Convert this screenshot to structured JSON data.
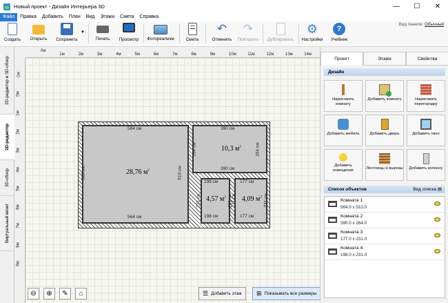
{
  "window": {
    "title": "Новый проект - Дизайн Интерьера 3D",
    "min": "—",
    "max": "☐",
    "close": "✕"
  },
  "menu": [
    "Файл",
    "Правка",
    "Добавить",
    "План",
    "Вид",
    "Этажи",
    "Смета",
    "Справка"
  ],
  "toolbar": {
    "items": [
      {
        "label": "Создать",
        "icon": "new-document-icon",
        "disabled": false
      },
      {
        "label": "Открыть",
        "icon": "folder-icon",
        "disabled": false
      },
      {
        "label": "Сохранить",
        "icon": "floppy-disk-icon",
        "disabled": false
      },
      {
        "label": "Печать",
        "icon": "printer-icon",
        "disabled": false
      },
      {
        "label": "Просмотр",
        "icon": "monitor-icon",
        "disabled": false
      },
      {
        "label": "Фотореализм",
        "icon": "photo-icon",
        "disabled": false
      },
      {
        "label": "Смета",
        "icon": "estimate-icon",
        "disabled": false
      },
      {
        "label": "Отменить",
        "icon": "undo-icon",
        "disabled": false
      },
      {
        "label": "Повторить",
        "icon": "redo-icon",
        "disabled": true
      },
      {
        "label": "Дублировать",
        "icon": "duplicate-icon",
        "disabled": true
      },
      {
        "label": "Настройки",
        "icon": "gear-icon",
        "disabled": false
      },
      {
        "label": "Учебник",
        "icon": "help-icon",
        "disabled": false
      }
    ],
    "panel_view_label": "Вид панели:",
    "panel_view_value": "Обычный"
  },
  "left_tabs": [
    "2D-редактор и 3D-обзор",
    "2D-редактор",
    "3D-обзор",
    "Виртуальный визит"
  ],
  "ruler": {
    "h": [
      "0м",
      "1м",
      "2м",
      "3м",
      "4м",
      "5м",
      "6м",
      "7м",
      "8м",
      "9м",
      "10м",
      "11м",
      "12м",
      "13м",
      "14м"
    ],
    "v": [
      "-1м",
      "0м",
      "1м",
      "2м",
      "3м",
      "4м",
      "5м",
      "6м",
      "7м",
      "8м",
      "9м"
    ]
  },
  "plan": {
    "room1": {
      "area": "28,76 м",
      "top": "564 см",
      "bottom": "564 см",
      "left": "510 см",
      "right": "510 см"
    },
    "room2": {
      "area": "10,3 м",
      "top": "390 см",
      "bottom": "390 см",
      "left": "264 см",
      "right": "264 см"
    },
    "room3": {
      "area": "4,57 м",
      "top": "198 см",
      "bottom": "198 см",
      "left": "231 см",
      "right": "231 см"
    },
    "room4": {
      "area": "4,09 м",
      "top": "177 см",
      "bottom": "177 см",
      "left": "231 см",
      "right": "231 см"
    },
    "sup": "2"
  },
  "bottom": {
    "add_floor": "Добавить этаж",
    "show_sizes": "Показывать все размеры"
  },
  "right": {
    "tabs": [
      "Проект",
      "Этажи",
      "Свойства"
    ],
    "design_title": "Дизайн",
    "design_buttons": [
      {
        "label": "Нарисовать комнату",
        "icon": "draw-room-icon"
      },
      {
        "label": "Добавить комнату",
        "icon": "add-room-icon"
      },
      {
        "label": "Нарисовать перегородку",
        "icon": "brick-wall-icon"
      },
      {
        "label": "Добавить мебель",
        "icon": "chair-icon"
      },
      {
        "label": "Добавить дверь",
        "icon": "door-icon"
      },
      {
        "label": "Добавить окно",
        "icon": "window-icon"
      },
      {
        "label": "Добавить освещение",
        "icon": "lamp-icon"
      },
      {
        "label": "Лестницы и вырезы",
        "icon": "stairs-icon"
      },
      {
        "label": "Добавить колонну",
        "icon": "column-icon"
      }
    ],
    "objects_title": "Список объектов",
    "objects_view": "Вид списка",
    "objects": [
      {
        "name": "Комната 1",
        "dims": "564.0 x 510.0"
      },
      {
        "name": "Комната 2",
        "dims": "390.0 x 264.0"
      },
      {
        "name": "Комната 3",
        "dims": "177.0 x 231.0"
      },
      {
        "name": "Комната 4",
        "dims": "198.0 x 231.0"
      }
    ]
  }
}
